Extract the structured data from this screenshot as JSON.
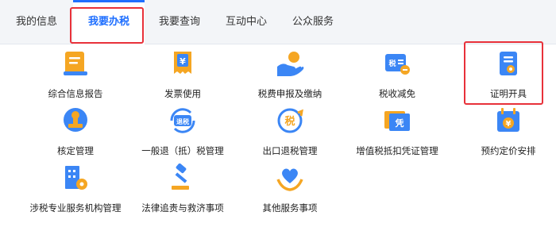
{
  "tabs": [
    {
      "label": "我的信息",
      "active": false
    },
    {
      "label": "我要办税",
      "active": true
    },
    {
      "label": "我要查询",
      "active": false
    },
    {
      "label": "互动中心",
      "active": false
    },
    {
      "label": "公众服务",
      "active": false
    }
  ],
  "services": [
    {
      "label": "综合信息报告",
      "icon": "report-document-icon"
    },
    {
      "label": "发票使用",
      "icon": "invoice-yen-icon"
    },
    {
      "label": "税费申报及缴纳",
      "icon": "hand-coin-icon"
    },
    {
      "label": "税收减免",
      "icon": "tax-reduction-icon"
    },
    {
      "label": "证明开具",
      "icon": "certificate-icon"
    },
    {
      "label": "核定管理",
      "icon": "stamp-icon"
    },
    {
      "label": "一般退（抵）税管理",
      "icon": "tax-refund-icon"
    },
    {
      "label": "出口退税管理",
      "icon": "export-refund-icon"
    },
    {
      "label": "增值税抵扣凭证管理",
      "icon": "voucher-icon"
    },
    {
      "label": "预约定价安排",
      "icon": "calendar-yen-icon"
    },
    {
      "label": "涉税专业服务机构管理",
      "icon": "building-gear-icon"
    },
    {
      "label": "法律追责与救济事项",
      "icon": "gavel-icon"
    },
    {
      "label": "其他服务事项",
      "icon": "heart-hands-icon"
    }
  ],
  "icon_badges": {
    "invoice": "¥",
    "tax_reduction": "税",
    "refund": "退税",
    "export": "税",
    "voucher": "凭",
    "calendar": "¥"
  },
  "colors": {
    "accent": "#1f6fff",
    "highlight": "#e8313a",
    "icon_blue": "#3b86f5",
    "icon_orange": "#f5a623"
  }
}
